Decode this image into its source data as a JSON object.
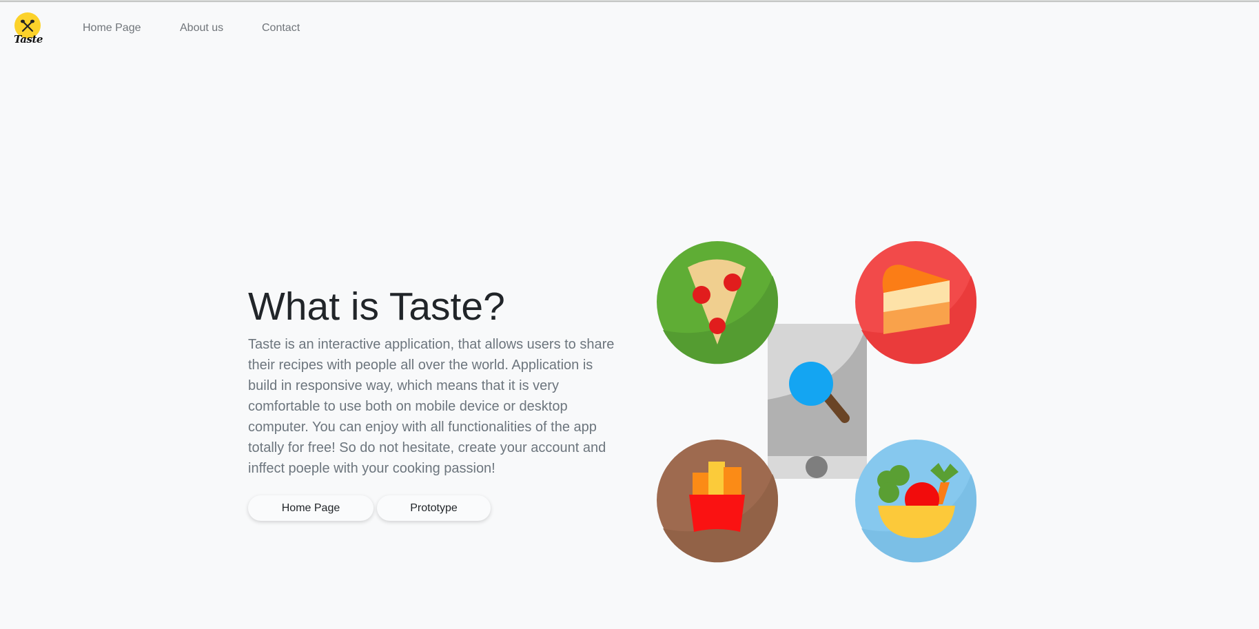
{
  "brand": {
    "logo_text": "Taste"
  },
  "nav": {
    "items": [
      {
        "label": "Home Page"
      },
      {
        "label": "About us"
      },
      {
        "label": "Contact"
      }
    ]
  },
  "hero": {
    "title": "What is Taste?",
    "description": "Taste is an interactive application, that allows users to share their recipes with people all over the world. Application is build in responsive way, which means that it is very comfortable to use both on mobile device or desktop computer. You can enjoy with all functionalities of the app totally for free! So do not hesitate, create your account and inffect poeple with your cooking passion!",
    "buttons": {
      "home_label": "Home Page",
      "prototype_label": "Prototype"
    }
  },
  "illustration": {
    "icons": [
      "pizza-icon",
      "cake-icon",
      "fries-icon",
      "salad-icon",
      "phone-search-icon"
    ],
    "colors": {
      "pizza_bg": "#5fad35",
      "cake_bg": "#f24a4a",
      "fries_bg": "#9e6a4f",
      "salad_bg": "#86c8ee",
      "logo": "#fcd22a",
      "search_lens": "#14a5f2"
    }
  }
}
